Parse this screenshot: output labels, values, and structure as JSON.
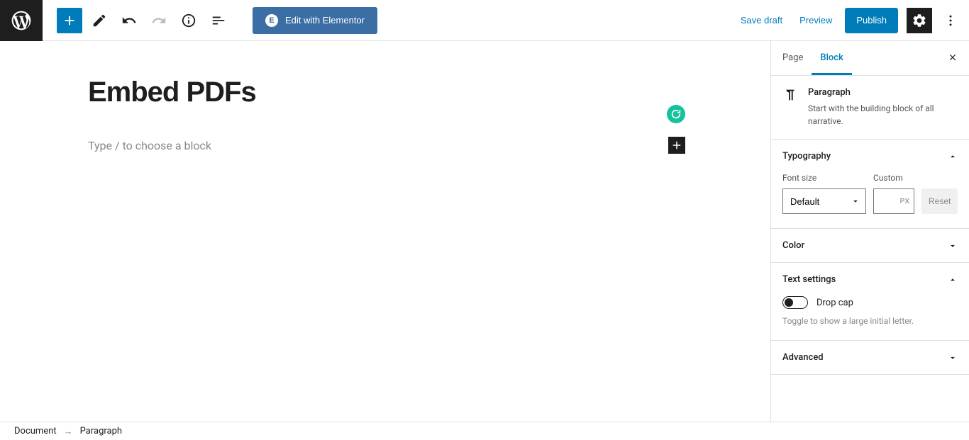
{
  "toolbar": {
    "elementor_label": "Edit with Elementor",
    "save_draft": "Save draft",
    "preview": "Preview",
    "publish": "Publish"
  },
  "editor": {
    "title": "Embed PDFs",
    "placeholder": "Type / to choose a block"
  },
  "sidebar": {
    "tabs": {
      "page": "Page",
      "block": "Block"
    },
    "block_info": {
      "title": "Paragraph",
      "desc": "Start with the building block of all narrative."
    },
    "typography": {
      "header": "Typography",
      "font_size_label": "Font size",
      "custom_label": "Custom",
      "default_option": "Default",
      "px_unit": "PX",
      "reset": "Reset"
    },
    "color": {
      "header": "Color"
    },
    "text_settings": {
      "header": "Text settings",
      "drop_cap": "Drop cap",
      "help": "Toggle to show a large initial letter."
    },
    "advanced": {
      "header": "Advanced"
    }
  },
  "footer": {
    "document": "Document",
    "paragraph": "Paragraph"
  }
}
